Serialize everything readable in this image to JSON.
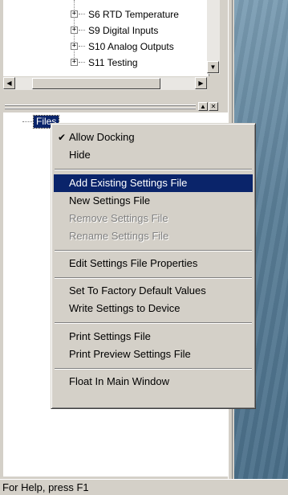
{
  "tree": {
    "items": [
      {
        "label": "S6 RTD Temperature",
        "expander": "+"
      },
      {
        "label": "S9 Digital Inputs",
        "expander": "+"
      },
      {
        "label": "S10 Analog Outputs",
        "expander": "+"
      },
      {
        "label": "S11 Testing",
        "expander": "+"
      }
    ]
  },
  "files_pane": {
    "node_label": "Files"
  },
  "context_menu": {
    "items": [
      {
        "label": "Allow Docking",
        "checked": true
      },
      {
        "label": "Hide"
      },
      {
        "label": "Add Existing Settings File",
        "highlighted": true
      },
      {
        "label": "New Settings File"
      },
      {
        "label": "Remove Settings File",
        "disabled": true
      },
      {
        "label": "Rename Settings File",
        "disabled": true
      },
      {
        "label": "Edit Settings File Properties"
      },
      {
        "label": "Set To Factory Default Values"
      },
      {
        "label": "Write Settings to Device"
      },
      {
        "label": "Print Settings File"
      },
      {
        "label": "Print Preview Settings File"
      },
      {
        "label": "Float In Main Window"
      }
    ],
    "check_glyph": "✔"
  },
  "scrollbars": {
    "down_arrow": "▼",
    "left_arrow": "◀",
    "right_arrow": "▶"
  },
  "pane_buttons": {
    "up_arrow": "▲",
    "close": "✕"
  },
  "status_bar": {
    "text": "For Help, press F1"
  },
  "colors": {
    "highlight": "#0a246a",
    "face": "#d4d0c8"
  }
}
